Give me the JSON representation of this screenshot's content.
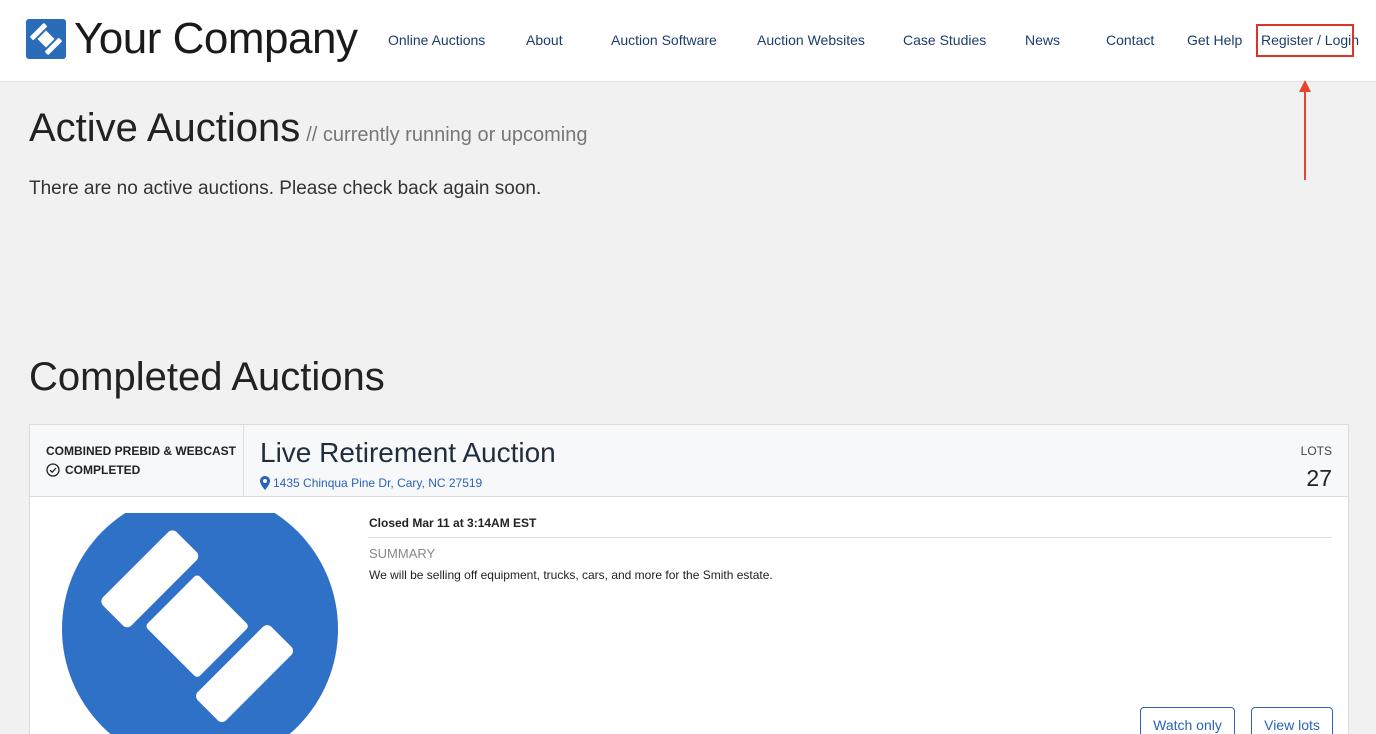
{
  "header": {
    "logo_text": "Your Company",
    "nav": [
      {
        "label": "Online Auctions"
      },
      {
        "label": "About"
      },
      {
        "label": "Auction Software"
      },
      {
        "label": "Auction Websites"
      },
      {
        "label": "Case Studies"
      },
      {
        "label": "News"
      },
      {
        "label": "Contact"
      },
      {
        "label": "Get Help"
      },
      {
        "label": "Register / Login"
      }
    ]
  },
  "active": {
    "title": "Active Auctions",
    "subtitle": "// currently running or upcoming",
    "empty_message": "There are no active auctions. Please check back again soon."
  },
  "completed": {
    "title": "Completed Auctions",
    "auctions": [
      {
        "type": "COMBINED PREBID & WEBCAST",
        "status": "COMPLETED",
        "title": "Live Retirement Auction",
        "location": "1435 Chinqua Pine Dr, Cary, NC 27519",
        "lots_label": "LOTS",
        "lots": "27",
        "closed": "Closed Mar 11 at 3:14AM EST",
        "summary_label": "SUMMARY",
        "summary": "We will be selling off equipment, trucks, cars, and more for the Smith estate.",
        "watch_label": "Watch only",
        "view_label": "View lots"
      }
    ]
  },
  "colors": {
    "accent": "#2a62b8",
    "logo_blue": "#3071c8",
    "highlight": "#d9352a",
    "page_bg": "#f1f1f1"
  },
  "icons": [
    "gavel-logo-icon",
    "check-circle-icon",
    "map-pin-icon",
    "annotation-arrow-icon"
  ]
}
